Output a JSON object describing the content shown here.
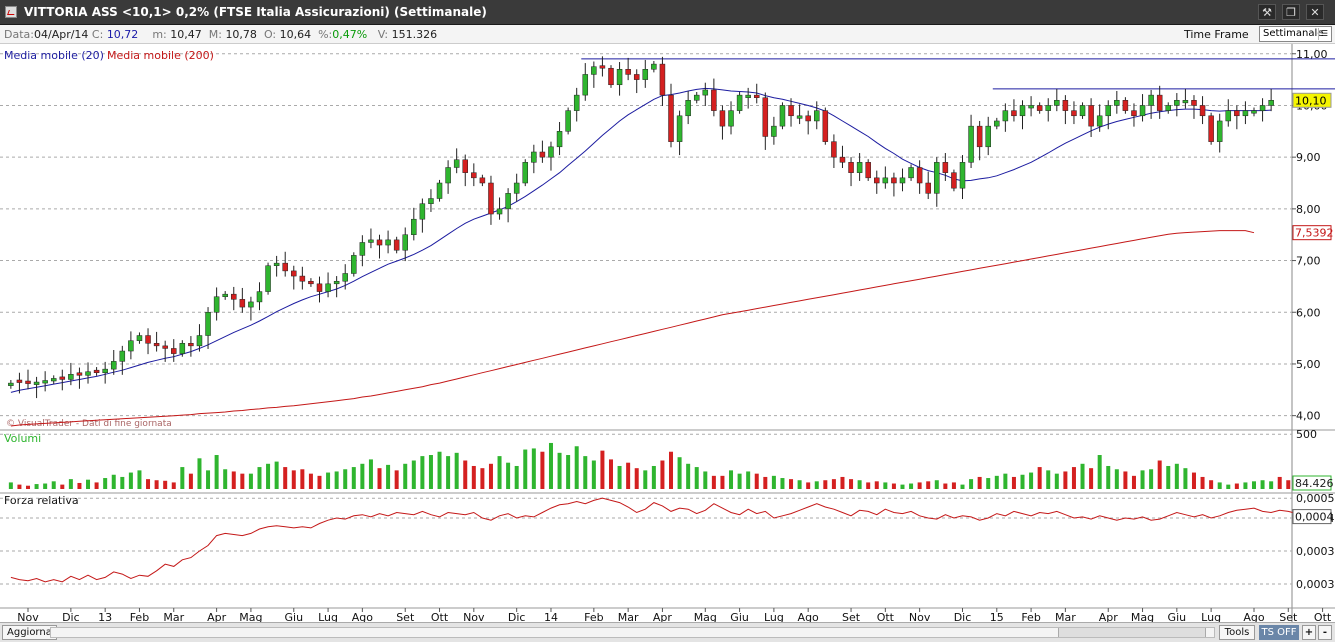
{
  "window": {
    "title": "VITTORIA ASS <10,1> 0,2%  (FTSE Italia Assicurazioni)  (Settimanale)"
  },
  "info": {
    "date_label": "Data:",
    "date": "04/Apr/14",
    "close_label": "C:",
    "close": "10,72",
    "min_label": "m:",
    "min": "10,47",
    "max_label": "M:",
    "max": "10,78",
    "open_label": "O:",
    "open": "10,64",
    "pct_label": "%:",
    "pct": "0,47%",
    "vol_label": "V:",
    "vol": "151.326"
  },
  "timeframe": {
    "label": "Time Frame",
    "value": "Settimanale"
  },
  "colors": {
    "up": "#2fb52f",
    "down": "#d42020",
    "ma20": "#1c1ca0",
    "ma200": "#c41818",
    "rs": "#c41818",
    "accent": "#6a86a8"
  },
  "chart_data": [
    {
      "type": "candlestick",
      "title": "",
      "legend": [
        {
          "name": "Media mobile (20)",
          "color": "#1c1ca0"
        },
        {
          "name": "Media mobile (200)",
          "color": "#c41818"
        }
      ],
      "watermark": "© VisualTrader - Dati di fine giornata",
      "ylim": [
        3.8,
        11.15
      ],
      "yticks": [
        "11,00",
        "10,00",
        "9,00",
        "8,00",
        "7,00",
        "6,00",
        "5,00",
        "4,00"
      ],
      "price_labels": [
        {
          "text": "10,10",
          "value": 10.1
        },
        {
          "text": "7,5392",
          "value": 7.5392
        }
      ],
      "xticks": [
        {
          "label": "Nov",
          "i": 2
        },
        {
          "label": "Dic",
          "i": 7
        },
        {
          "label": "13",
          "i": 11
        },
        {
          "label": "Feb",
          "i": 15
        },
        {
          "label": "Mar",
          "i": 19
        },
        {
          "label": "Apr",
          "i": 24
        },
        {
          "label": "Mag",
          "i": 28
        },
        {
          "label": "Giu",
          "i": 33
        },
        {
          "label": "Lug",
          "i": 37
        },
        {
          "label": "Ago",
          "i": 41
        },
        {
          "label": "Set",
          "i": 46
        },
        {
          "label": "Ott",
          "i": 50
        },
        {
          "label": "Nov",
          "i": 54
        },
        {
          "label": "Dic",
          "i": 59
        },
        {
          "label": "14",
          "i": 63
        },
        {
          "label": "Feb",
          "i": 68
        },
        {
          "label": "Mar",
          "i": 72
        },
        {
          "label": "Apr",
          "i": 76
        },
        {
          "label": "Mag",
          "i": 81
        },
        {
          "label": "Giu",
          "i": 85
        },
        {
          "label": "Lug",
          "i": 89
        },
        {
          "label": "Ago",
          "i": 93
        },
        {
          "label": "Set",
          "i": 98
        },
        {
          "label": "Ott",
          "i": 102
        },
        {
          "label": "Nov",
          "i": 106
        },
        {
          "label": "Dic",
          "i": 111
        },
        {
          "label": "15",
          "i": 115
        },
        {
          "label": "Feb",
          "i": 119
        },
        {
          "label": "Mar",
          "i": 123
        },
        {
          "label": "Apr",
          "i": 128
        },
        {
          "label": "Mag",
          "i": 132
        },
        {
          "label": "Giu",
          "i": 136
        },
        {
          "label": "Lug",
          "i": 140
        },
        {
          "label": "Ago",
          "i": 145
        },
        {
          "label": "Set",
          "i": 149
        },
        {
          "label": "Ott",
          "i": 153
        }
      ],
      "close": [
        4.63,
        4.64,
        4.62,
        4.65,
        4.68,
        4.72,
        4.7,
        4.8,
        4.78,
        4.85,
        4.83,
        4.9,
        5.05,
        5.25,
        5.45,
        5.55,
        5.4,
        5.35,
        5.3,
        5.2,
        5.4,
        5.35,
        5.55,
        6.0,
        6.3,
        6.35,
        6.25,
        6.1,
        6.2,
        6.4,
        6.9,
        6.95,
        6.8,
        6.7,
        6.6,
        6.55,
        6.4,
        6.55,
        6.6,
        6.75,
        7.1,
        7.35,
        7.4,
        7.3,
        7.4,
        7.2,
        7.5,
        7.8,
        8.1,
        8.2,
        8.5,
        8.8,
        8.95,
        8.7,
        8.6,
        8.5,
        7.9,
        8.0,
        8.3,
        8.5,
        8.9,
        9.1,
        9.0,
        9.2,
        9.5,
        9.9,
        10.2,
        10.6,
        10.75,
        10.72,
        10.4,
        10.7,
        10.6,
        10.5,
        10.7,
        10.8,
        10.2,
        9.3,
        9.8,
        10.1,
        10.2,
        10.3,
        9.9,
        9.6,
        9.9,
        10.2,
        10.2,
        10.15,
        9.4,
        9.6,
        10.0,
        9.8,
        9.8,
        9.7,
        9.9,
        9.3,
        9.0,
        8.9,
        8.7,
        8.9,
        8.6,
        8.5,
        8.6,
        8.5,
        8.6,
        8.8,
        8.5,
        8.3,
        8.9,
        8.7,
        8.4,
        8.9,
        9.6,
        9.2,
        9.6,
        9.7,
        9.9,
        9.8,
        10.0,
        10.0,
        9.9,
        10.0,
        10.1,
        9.9,
        9.8,
        10.0,
        9.6,
        9.8,
        10.0,
        10.1,
        9.9,
        9.8,
        10.0,
        10.2,
        9.9,
        10.0,
        10.1,
        10.1,
        10.0,
        9.8,
        9.3,
        9.7,
        9.9,
        9.8,
        9.9,
        9.9,
        10.0,
        10.1
      ],
      "up": [
        1,
        0,
        0,
        1,
        1,
        1,
        0,
        1,
        0,
        1,
        0,
        1,
        1,
        1,
        1,
        1,
        0,
        0,
        0,
        0,
        1,
        0,
        1,
        1,
        1,
        1,
        0,
        0,
        1,
        1,
        1,
        1,
        0,
        0,
        0,
        0,
        0,
        1,
        1,
        1,
        1,
        1,
        1,
        0,
        1,
        0,
        1,
        1,
        1,
        1,
        1,
        1,
        1,
        0,
        0,
        0,
        0,
        1,
        1,
        1,
        1,
        1,
        0,
        1,
        1,
        1,
        1,
        1,
        1,
        0,
        0,
        1,
        0,
        0,
        1,
        1,
        0,
        0,
        1,
        1,
        1,
        1,
        0,
        0,
        1,
        1,
        1,
        0,
        0,
        1,
        1,
        0,
        1,
        0,
        1,
        0,
        0,
        0,
        0,
        1,
        0,
        0,
        1,
        0,
        1,
        1,
        0,
        0,
        1,
        0,
        0,
        1,
        1,
        0,
        1,
        1,
        1,
        0,
        1,
        1,
        0,
        1,
        1,
        0,
        0,
        1,
        0,
        1,
        1,
        1,
        0,
        0,
        1,
        1,
        0,
        1,
        1,
        1,
        0,
        0,
        0,
        1,
        1,
        0,
        1,
        1,
        1,
        1
      ],
      "ma20": [
        4.45,
        4.49,
        4.52,
        4.55,
        4.58,
        4.61,
        4.64,
        4.67,
        4.7,
        4.73,
        4.76,
        4.8,
        4.84,
        4.88,
        4.93,
        4.98,
        5.03,
        5.07,
        5.11,
        5.14,
        5.19,
        5.24,
        5.3,
        5.37,
        5.45,
        5.53,
        5.61,
        5.68,
        5.75,
        5.83,
        5.92,
        6.01,
        6.09,
        6.17,
        6.24,
        6.3,
        6.35,
        6.4,
        6.45,
        6.52,
        6.6,
        6.69,
        6.77,
        6.85,
        6.93,
        6.99,
        7.05,
        7.12,
        7.2,
        7.29,
        7.4,
        7.51,
        7.62,
        7.72,
        7.8,
        7.86,
        7.92,
        7.98,
        8.05,
        8.14,
        8.24,
        8.35,
        8.46,
        8.58,
        8.7,
        8.84,
        8.98,
        9.12,
        9.27,
        9.42,
        9.56,
        9.7,
        9.82,
        9.92,
        10.02,
        10.12,
        10.19,
        10.21,
        10.24,
        10.28,
        10.31,
        10.33,
        10.32,
        10.3,
        10.28,
        10.27,
        10.26,
        10.24,
        10.19,
        10.15,
        10.12,
        10.08,
        10.04,
        10.0,
        9.95,
        9.89,
        9.8,
        9.7,
        9.6,
        9.5,
        9.4,
        9.28,
        9.17,
        9.07,
        8.96,
        8.88,
        8.8,
        8.74,
        8.7,
        8.65,
        8.58,
        8.54,
        8.55,
        8.58,
        8.6,
        8.64,
        8.7,
        8.76,
        8.83,
        8.9,
        8.99,
        9.08,
        9.18,
        9.27,
        9.35,
        9.43,
        9.51,
        9.58,
        9.64,
        9.69,
        9.73,
        9.77,
        9.81,
        9.85,
        9.88,
        9.9,
        9.92,
        9.93,
        9.93,
        9.92,
        9.9,
        9.89,
        9.9,
        9.9,
        9.9,
        9.9,
        9.9,
        9.91
      ],
      "ma200": [
        3.8,
        3.82,
        3.83,
        3.84,
        3.85,
        3.86,
        3.87,
        3.88,
        3.89,
        3.9,
        3.91,
        3.92,
        3.93,
        3.94,
        3.95,
        3.96,
        3.97,
        3.98,
        3.99,
        4.0,
        4.01,
        4.02,
        4.04,
        4.05,
        4.06,
        4.07,
        4.09,
        4.1,
        4.12,
        4.13,
        4.15,
        4.16,
        4.18,
        4.19,
        4.21,
        4.23,
        4.25,
        4.27,
        4.29,
        4.31,
        4.33,
        4.36,
        4.38,
        4.41,
        4.44,
        4.47,
        4.5,
        4.53,
        4.56,
        4.6,
        4.63,
        4.67,
        4.71,
        4.75,
        4.79,
        4.83,
        4.87,
        4.91,
        4.95,
        4.99,
        5.03,
        5.07,
        5.11,
        5.15,
        5.19,
        5.23,
        5.27,
        5.31,
        5.35,
        5.39,
        5.43,
        5.47,
        5.51,
        5.55,
        5.59,
        5.63,
        5.67,
        5.71,
        5.75,
        5.79,
        5.83,
        5.87,
        5.91,
        5.95,
        5.98,
        6.01,
        6.04,
        6.07,
        6.1,
        6.13,
        6.16,
        6.19,
        6.22,
        6.25,
        6.28,
        6.31,
        6.34,
        6.37,
        6.4,
        6.43,
        6.46,
        6.49,
        6.52,
        6.55,
        6.58,
        6.61,
        6.64,
        6.67,
        6.7,
        6.73,
        6.76,
        6.79,
        6.82,
        6.85,
        6.88,
        6.91,
        6.94,
        6.97,
        7.0,
        7.03,
        7.06,
        7.09,
        7.12,
        7.15,
        7.18,
        7.21,
        7.24,
        7.27,
        7.3,
        7.33,
        7.36,
        7.39,
        7.42,
        7.45,
        7.48,
        7.51,
        7.53,
        7.54,
        7.55,
        7.56,
        7.57,
        7.58,
        7.58,
        7.58,
        7.58,
        7.539
      ],
      "hlines": [
        {
          "value": 10.9,
          "from": 67,
          "to": 155
        },
        {
          "value": 10.32,
          "from": 115,
          "to": 155
        }
      ]
    },
    {
      "type": "bar",
      "title": "Volumi",
      "yticks": [
        "500"
      ],
      "last_label": "84.426",
      "ylim": [
        0,
        520
      ],
      "volume": [
        60,
        40,
        30,
        45,
        50,
        70,
        40,
        90,
        55,
        85,
        60,
        100,
        130,
        110,
        150,
        170,
        90,
        80,
        75,
        60,
        200,
        140,
        280,
        170,
        310,
        180,
        160,
        140,
        140,
        200,
        230,
        250,
        200,
        170,
        180,
        140,
        120,
        150,
        160,
        180,
        200,
        230,
        270,
        190,
        220,
        170,
        230,
        260,
        300,
        310,
        340,
        300,
        330,
        260,
        210,
        190,
        230,
        300,
        240,
        210,
        360,
        370,
        340,
        420,
        330,
        310,
        390,
        300,
        260,
        350,
        270,
        210,
        240,
        190,
        170,
        210,
        260,
        340,
        290,
        230,
        200,
        160,
        120,
        120,
        170,
        140,
        160,
        140,
        110,
        120,
        100,
        90,
        80,
        60,
        70,
        80,
        90,
        110,
        90,
        80,
        60,
        70,
        60,
        50,
        40,
        50,
        60,
        70,
        80,
        50,
        60,
        40,
        90,
        110,
        100,
        120,
        140,
        110,
        130,
        150,
        200,
        170,
        140,
        160,
        200,
        230,
        190,
        310,
        210,
        180,
        160,
        120,
        170,
        180,
        260,
        210,
        230,
        190,
        150,
        110,
        80,
        60,
        40,
        50,
        60,
        70,
        80,
        70,
        110,
        80,
        60,
        40
      ],
      "up_ref": "up"
    },
    {
      "type": "line",
      "title": "Forza relativa",
      "yticks": [
        "0,0005",
        "0,0004",
        "0,0003",
        "0,0003"
      ],
      "last_label": "0,0004",
      "rs": [
        0.26,
        0.24,
        0.23,
        0.25,
        0.22,
        0.24,
        0.22,
        0.27,
        0.24,
        0.28,
        0.24,
        0.26,
        0.31,
        0.29,
        0.25,
        0.28,
        0.27,
        0.32,
        0.38,
        0.36,
        0.42,
        0.44,
        0.5,
        0.55,
        0.64,
        0.66,
        0.65,
        0.64,
        0.66,
        0.7,
        0.72,
        0.73,
        0.72,
        0.71,
        0.72,
        0.71,
        0.75,
        0.78,
        0.8,
        0.79,
        0.82,
        0.83,
        0.81,
        0.84,
        0.82,
        0.85,
        0.84,
        0.83,
        0.86,
        0.83,
        0.81,
        0.85,
        0.84,
        0.83,
        0.85,
        0.8,
        0.78,
        0.82,
        0.84,
        0.8,
        0.82,
        0.81,
        0.85,
        0.89,
        0.92,
        0.93,
        0.95,
        0.93,
        0.96,
        0.98,
        0.96,
        0.94,
        0.9,
        0.85,
        0.88,
        0.94,
        0.91,
        0.86,
        0.89,
        0.88,
        0.84,
        0.87,
        0.93,
        0.89,
        0.85,
        0.83,
        0.88,
        0.84,
        0.86,
        0.8,
        0.82,
        0.84,
        0.87,
        0.9,
        0.93,
        0.9,
        0.88,
        0.85,
        0.82,
        0.87,
        0.86,
        0.83,
        0.88,
        0.85,
        0.84,
        0.86,
        0.82,
        0.8,
        0.79,
        0.83,
        0.8,
        0.82,
        0.81,
        0.78,
        0.8,
        0.84,
        0.82,
        0.86,
        0.84,
        0.82,
        0.85,
        0.84,
        0.86,
        0.83,
        0.8,
        0.81,
        0.79,
        0.82,
        0.8,
        0.78,
        0.8,
        0.79,
        0.81,
        0.78,
        0.79,
        0.82,
        0.85,
        0.83,
        0.81,
        0.83,
        0.8,
        0.82,
        0.85,
        0.87,
        0.88,
        0.89,
        0.86,
        0.85,
        0.87,
        0.86,
        0.84
      ]
    }
  ],
  "bottom": {
    "refresh": "Aggiorna",
    "tools": "Tools",
    "ts_off": "TS OFF",
    "plus": "+",
    "minus": "-"
  }
}
